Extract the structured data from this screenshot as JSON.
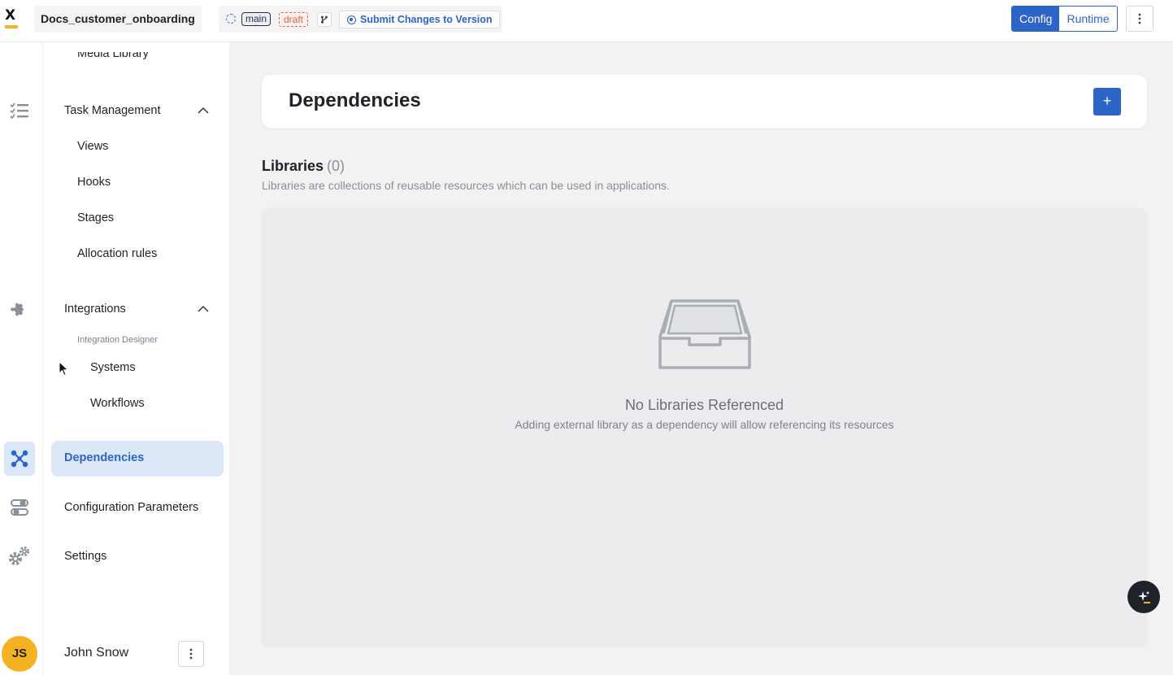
{
  "topbar": {
    "logo_letter": "X",
    "project_name": "Docs_customer_onboarding",
    "branch": "main",
    "status": "draft",
    "submit_label": "Submit Changes to Version",
    "mode_config": "Config",
    "mode_runtime": "Runtime"
  },
  "nav": {
    "partial_item": "Media Library",
    "task_management": {
      "label": "Task Management",
      "items": [
        "Views",
        "Hooks",
        "Stages",
        "Allocation rules"
      ]
    },
    "integrations": {
      "label": "Integrations",
      "group_label": "Integration Designer",
      "items": [
        "Systems",
        "Workflows"
      ]
    },
    "dependencies": "Dependencies",
    "configuration_parameters": "Configuration Parameters",
    "settings": "Settings"
  },
  "user": {
    "initials": "JS",
    "name": "John Snow"
  },
  "main": {
    "title": "Dependencies",
    "add_label": "+",
    "libraries_label": "Libraries",
    "libraries_count": "(0)",
    "libraries_description": "Libraries are collections of reusable resources which can be used in applications.",
    "empty_title": "No Libraries Referenced",
    "empty_subtitle": "Adding external library as a dependency will allow referencing its resources"
  },
  "colors": {
    "accent": "#2c64c8",
    "accent_light": "#dce8f7",
    "draft": "#e0674d",
    "avatar": "#f5b324"
  }
}
